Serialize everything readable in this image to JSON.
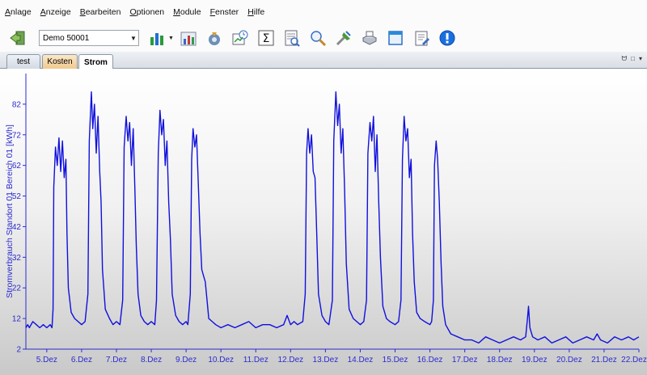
{
  "menu": [
    "Anlage",
    "Anzeige",
    "Bearbeiten",
    "Optionen",
    "Module",
    "Fenster",
    "Hilfe"
  ],
  "toolbar": {
    "combo_value": "Demo 50001",
    "icons": [
      "exit-icon",
      "bar-chart-icon",
      "multi-chart-icon",
      "wizard-icon",
      "schedule-icon",
      "sum-icon",
      "report-icon",
      "zoom-icon",
      "tools-icon",
      "print-icon",
      "window-icon",
      "notes-icon",
      "info-icon"
    ]
  },
  "tabs": [
    {
      "label": "test",
      "active": false
    },
    {
      "label": "Kosten",
      "active": false
    },
    {
      "label": "Strom",
      "active": true
    }
  ],
  "window_controls": [
    "ᗢ",
    "□",
    "▾"
  ],
  "colors": {
    "line": "#1010dd",
    "axis_text": "#2b2bd0",
    "kosten_tab": "#f0c98e"
  },
  "chart_data": {
    "type": "line",
    "ylabel": "Stromverbrauch  Standort 01 Bereich 01 [kWh]",
    "xlabel": "",
    "y_ticks": [
      2,
      12,
      22,
      32,
      42,
      52,
      62,
      72,
      82
    ],
    "ylim": [
      2,
      92
    ],
    "xlim": [
      4.4,
      22.0
    ],
    "x_ticks": [
      {
        "x": 5,
        "label": "5.Dez"
      },
      {
        "x": 6,
        "label": "6.Dez"
      },
      {
        "x": 7,
        "label": "7.Dez"
      },
      {
        "x": 8,
        "label": "8.Dez"
      },
      {
        "x": 9,
        "label": "9.Dez"
      },
      {
        "x": 10,
        "label": "10.Dez"
      },
      {
        "x": 11,
        "label": "11.Dez"
      },
      {
        "x": 12,
        "label": "12.Dez"
      },
      {
        "x": 13,
        "label": "13.Dez"
      },
      {
        "x": 14,
        "label": "14.Dez"
      },
      {
        "x": 15,
        "label": "15.Dez"
      },
      {
        "x": 16,
        "label": "16.Dez"
      },
      {
        "x": 17,
        "label": "17.Dez"
      },
      {
        "x": 18,
        "label": "18.Dez"
      },
      {
        "x": 19,
        "label": "19.Dez"
      },
      {
        "x": 20,
        "label": "20.Dez"
      },
      {
        "x": 21,
        "label": "21.Dez"
      },
      {
        "x": 22,
        "label": "22.Dez"
      }
    ],
    "series": [
      {
        "values": [
          [
            4.4,
            9
          ],
          [
            4.45,
            10
          ],
          [
            4.5,
            9
          ],
          [
            4.6,
            11
          ],
          [
            4.7,
            10
          ],
          [
            4.8,
            9
          ],
          [
            4.9,
            10
          ],
          [
            5.0,
            9
          ],
          [
            5.1,
            10
          ],
          [
            5.15,
            9
          ],
          [
            5.18,
            15
          ],
          [
            5.2,
            55
          ],
          [
            5.25,
            68
          ],
          [
            5.3,
            62
          ],
          [
            5.35,
            71
          ],
          [
            5.4,
            60
          ],
          [
            5.45,
            70
          ],
          [
            5.5,
            58
          ],
          [
            5.55,
            64
          ],
          [
            5.58,
            40
          ],
          [
            5.62,
            22
          ],
          [
            5.7,
            14
          ],
          [
            5.8,
            12
          ],
          [
            5.9,
            11
          ],
          [
            6.0,
            10
          ],
          [
            6.1,
            11
          ],
          [
            6.18,
            20
          ],
          [
            6.22,
            70
          ],
          [
            6.28,
            86
          ],
          [
            6.32,
            74
          ],
          [
            6.37,
            82
          ],
          [
            6.42,
            66
          ],
          [
            6.47,
            78
          ],
          [
            6.52,
            60
          ],
          [
            6.56,
            50
          ],
          [
            6.6,
            28
          ],
          [
            6.68,
            15
          ],
          [
            6.8,
            12
          ],
          [
            6.9,
            10
          ],
          [
            7.0,
            11
          ],
          [
            7.1,
            10
          ],
          [
            7.18,
            18
          ],
          [
            7.22,
            68
          ],
          [
            7.28,
            78
          ],
          [
            7.33,
            70
          ],
          [
            7.38,
            76
          ],
          [
            7.43,
            62
          ],
          [
            7.48,
            74
          ],
          [
            7.53,
            54
          ],
          [
            7.57,
            36
          ],
          [
            7.62,
            20
          ],
          [
            7.7,
            13
          ],
          [
            7.8,
            11
          ],
          [
            7.9,
            10
          ],
          [
            8.0,
            11
          ],
          [
            8.1,
            10
          ],
          [
            8.15,
            18
          ],
          [
            8.2,
            66
          ],
          [
            8.25,
            80
          ],
          [
            8.3,
            72
          ],
          [
            8.35,
            77
          ],
          [
            8.4,
            62
          ],
          [
            8.45,
            70
          ],
          [
            8.5,
            50
          ],
          [
            8.55,
            38
          ],
          [
            8.6,
            20
          ],
          [
            8.7,
            13
          ],
          [
            8.8,
            11
          ],
          [
            8.9,
            10
          ],
          [
            9.0,
            11
          ],
          [
            9.05,
            10
          ],
          [
            9.12,
            20
          ],
          [
            9.16,
            64
          ],
          [
            9.2,
            74
          ],
          [
            9.25,
            68
          ],
          [
            9.3,
            72
          ],
          [
            9.35,
            56
          ],
          [
            9.4,
            40
          ],
          [
            9.45,
            28
          ],
          [
            9.5,
            26
          ],
          [
            9.55,
            24
          ],
          [
            9.6,
            18
          ],
          [
            9.65,
            12
          ],
          [
            9.75,
            11
          ],
          [
            9.85,
            10
          ],
          [
            10.0,
            9
          ],
          [
            10.2,
            10
          ],
          [
            10.4,
            9
          ],
          [
            10.6,
            10
          ],
          [
            10.8,
            11
          ],
          [
            11.0,
            9
          ],
          [
            11.2,
            10
          ],
          [
            11.4,
            10
          ],
          [
            11.6,
            9
          ],
          [
            11.8,
            10
          ],
          [
            11.9,
            13
          ],
          [
            12.0,
            10
          ],
          [
            12.1,
            11
          ],
          [
            12.2,
            10
          ],
          [
            12.35,
            11
          ],
          [
            12.42,
            20
          ],
          [
            12.46,
            66
          ],
          [
            12.5,
            74
          ],
          [
            12.55,
            66
          ],
          [
            12.6,
            72
          ],
          [
            12.65,
            60
          ],
          [
            12.7,
            58
          ],
          [
            12.75,
            40
          ],
          [
            12.8,
            20
          ],
          [
            12.9,
            13
          ],
          [
            13.0,
            11
          ],
          [
            13.1,
            10
          ],
          [
            13.2,
            18
          ],
          [
            13.24,
            70
          ],
          [
            13.3,
            86
          ],
          [
            13.35,
            75
          ],
          [
            13.4,
            82
          ],
          [
            13.45,
            66
          ],
          [
            13.5,
            74
          ],
          [
            13.55,
            54
          ],
          [
            13.6,
            30
          ],
          [
            13.68,
            15
          ],
          [
            13.8,
            12
          ],
          [
            13.9,
            11
          ],
          [
            14.0,
            10
          ],
          [
            14.1,
            11
          ],
          [
            14.18,
            18
          ],
          [
            14.22,
            66
          ],
          [
            14.28,
            76
          ],
          [
            14.33,
            70
          ],
          [
            14.38,
            78
          ],
          [
            14.43,
            60
          ],
          [
            14.48,
            72
          ],
          [
            14.53,
            50
          ],
          [
            14.58,
            32
          ],
          [
            14.65,
            16
          ],
          [
            14.75,
            12
          ],
          [
            14.85,
            11
          ],
          [
            15.0,
            10
          ],
          [
            15.1,
            11
          ],
          [
            15.17,
            18
          ],
          [
            15.21,
            64
          ],
          [
            15.26,
            78
          ],
          [
            15.31,
            70
          ],
          [
            15.36,
            74
          ],
          [
            15.41,
            58
          ],
          [
            15.46,
            64
          ],
          [
            15.5,
            40
          ],
          [
            15.55,
            24
          ],
          [
            15.62,
            14
          ],
          [
            15.72,
            12
          ],
          [
            15.85,
            11
          ],
          [
            16.0,
            10
          ],
          [
            16.05,
            11
          ],
          [
            16.1,
            18
          ],
          [
            16.13,
            62
          ],
          [
            16.18,
            70
          ],
          [
            16.22,
            64
          ],
          [
            16.27,
            50
          ],
          [
            16.32,
            30
          ],
          [
            16.37,
            16
          ],
          [
            16.45,
            10
          ],
          [
            16.6,
            7
          ],
          [
            16.8,
            6
          ],
          [
            17.0,
            5
          ],
          [
            17.2,
            5
          ],
          [
            17.4,
            4
          ],
          [
            17.6,
            6
          ],
          [
            17.8,
            5
          ],
          [
            18.0,
            4
          ],
          [
            18.2,
            5
          ],
          [
            18.4,
            6
          ],
          [
            18.6,
            5
          ],
          [
            18.75,
            6
          ],
          [
            18.8,
            12
          ],
          [
            18.83,
            16
          ],
          [
            18.87,
            9
          ],
          [
            18.95,
            6
          ],
          [
            19.1,
            5
          ],
          [
            19.3,
            6
          ],
          [
            19.5,
            4
          ],
          [
            19.7,
            5
          ],
          [
            19.9,
            6
          ],
          [
            20.1,
            4
          ],
          [
            20.3,
            5
          ],
          [
            20.5,
            6
          ],
          [
            20.7,
            5
          ],
          [
            20.8,
            7
          ],
          [
            20.9,
            5
          ],
          [
            21.1,
            4
          ],
          [
            21.3,
            6
          ],
          [
            21.5,
            5
          ],
          [
            21.7,
            6
          ],
          [
            21.85,
            5
          ],
          [
            22.0,
            6
          ]
        ]
      }
    ],
    "grid": false
  }
}
